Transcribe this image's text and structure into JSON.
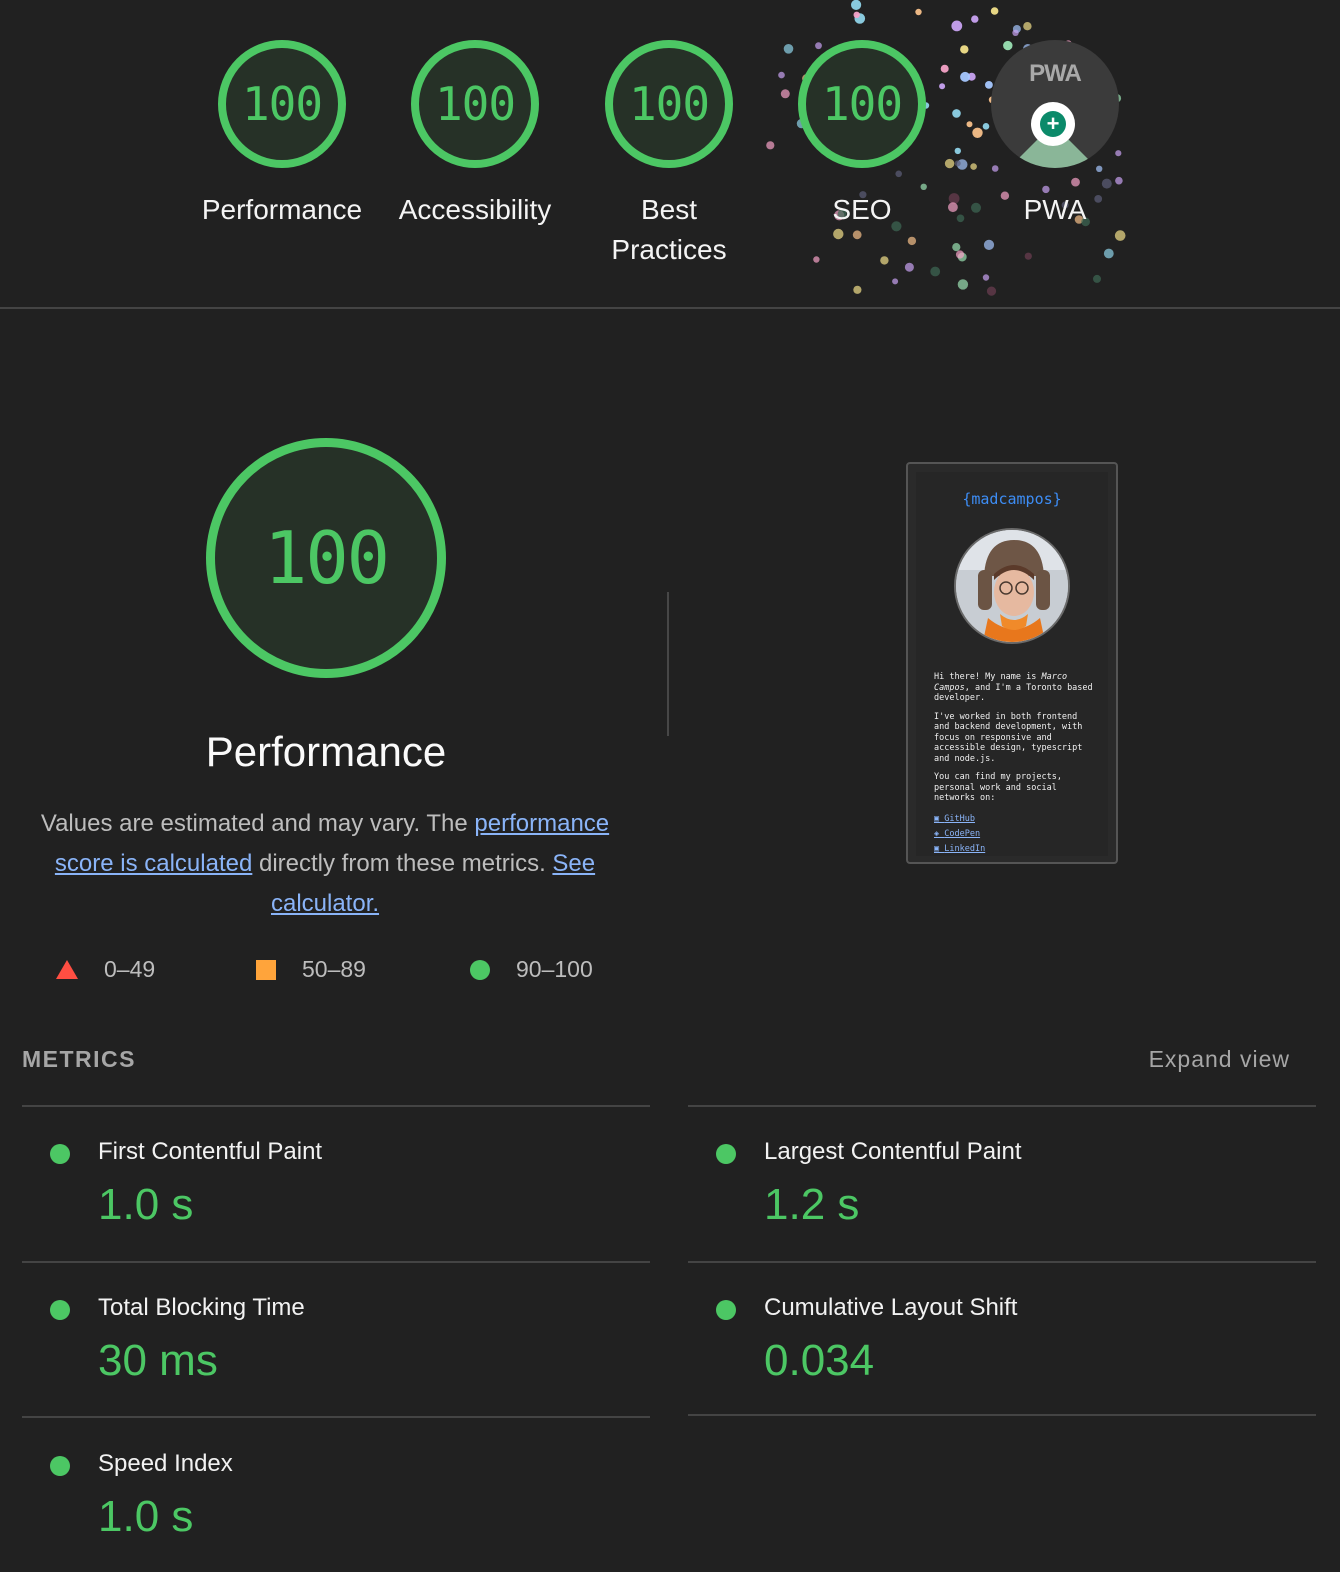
{
  "categories": [
    {
      "score": "100",
      "label": "Performance"
    },
    {
      "score": "100",
      "label": "Accessibility"
    },
    {
      "score": "100",
      "label": "Best Practices"
    },
    {
      "score": "100",
      "label": "SEO"
    },
    {
      "label": "PWA",
      "badge_text": "PWA"
    }
  ],
  "performance": {
    "score": "100",
    "title": "Performance",
    "desc_prefix": "Values are estimated and may vary. The ",
    "desc_link1": "performance score is calculated",
    "desc_middle": " directly from these metrics. ",
    "desc_link2": "See calculator."
  },
  "legend": {
    "fail": "0–49",
    "average": "50–89",
    "pass": "90–100"
  },
  "screenshot": {
    "brand": "{madcampos}",
    "para1_a": "Hi there! My name is ",
    "para1_name": "Marco Campos",
    "para1_b": ", and I'm a Toronto based developer.",
    "para2": "I've worked in both frontend and backend development, with focus on responsive and accessible design, typescript and node.js.",
    "para3": "You can find my projects, personal work and social networks on:",
    "links": [
      "GitHub",
      "CodePen",
      "LinkedIn"
    ]
  },
  "metrics": {
    "heading": "METRICS",
    "expand_label": "Expand view",
    "items": [
      {
        "name": "First Contentful Paint",
        "value": "1.0 s"
      },
      {
        "name": "Largest Contentful Paint",
        "value": "1.2 s"
      },
      {
        "name": "Total Blocking Time",
        "value": "30 ms"
      },
      {
        "name": "Cumulative Layout Shift",
        "value": "0.034"
      },
      {
        "name": "Speed Index",
        "value": "1.0 s"
      }
    ]
  },
  "colors": {
    "pass": "#4cc764",
    "average": "#ffa43b",
    "fail": "#ff4e42",
    "background": "#212121",
    "link": "#8ab4f8"
  }
}
